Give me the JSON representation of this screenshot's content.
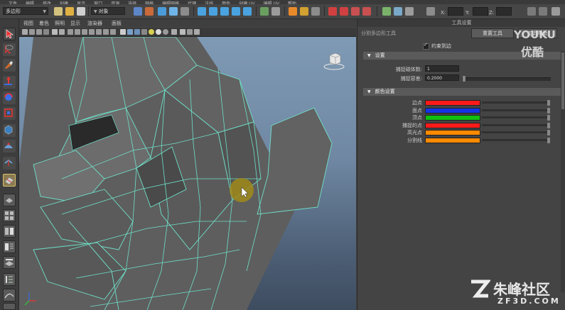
{
  "menu": [
    "文件",
    "编辑",
    "修改",
    "创建",
    "显示",
    "窗口",
    "资源",
    "选择",
    "网格",
    "编辑网格",
    "代理",
    "法线",
    "颜色",
    "创建 UV",
    "编辑 UV",
    "帮助"
  ],
  "toolbar": {
    "mode_select": "多边形",
    "object_select": "对象",
    "x_label": "X:",
    "y_label": "Y:",
    "z_label": "Z:"
  },
  "viewport_menu": [
    "视图",
    "着色",
    "照明",
    "显示",
    "渲染器",
    "面板"
  ],
  "panel": {
    "title": "工具设置",
    "tool_name": "分割多边形工具",
    "reset_button": "重置工具",
    "help_button": "工具帮助",
    "snap_checkbox_label": "约束到边",
    "settings_section": "设置",
    "snap_points_label": "捕捉磁体数:",
    "snap_points_value": "1",
    "tolerance_label": "捕捉容差:",
    "tolerance_value": "0.2000",
    "color_section": "颜色设置",
    "colors": [
      {
        "label": "边点",
        "color": "#ff1a1a"
      },
      {
        "label": "面点",
        "color": "#1433e6"
      },
      {
        "label": "顶点",
        "color": "#10c010"
      },
      {
        "label": "捕捉的点",
        "color": "#ff1a1a"
      },
      {
        "label": "高光点",
        "color": "#ff8a00"
      },
      {
        "label": "分割线",
        "color": "#ff8a00"
      }
    ]
  },
  "watermark": {
    "top_logo": "YOUKU",
    "top_logo_cn": "优酷",
    "bottom_logo_cn": "朱峰社区",
    "bottom_url": "ZF3D.COM"
  }
}
